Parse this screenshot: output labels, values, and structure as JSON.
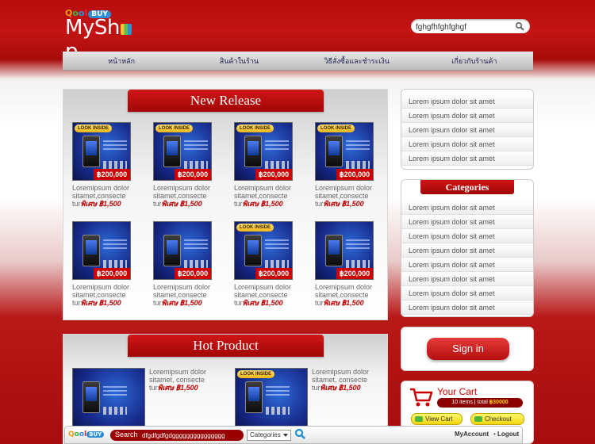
{
  "header": {
    "logo_small": [
      "Q",
      "o",
      "o",
      "l"
    ],
    "logo_buy": "BUY",
    "logo_big_1": "MySh",
    "logo_big_2": "p",
    "search_value": "fghgfhfghfghgf"
  },
  "nav": [
    "หน้าหลัก",
    "สินค้าในร้าน",
    "วิธีสั่งซื้อและชำระเงิน",
    "เกี่ยวกับร้านค้า"
  ],
  "new_release": {
    "title": "New Release",
    "products": [
      {
        "badge": "LOOK INSIDE",
        "price": "฿200,000",
        "desc": "Loremipsum dolor sitamet,consecte tur",
        "sale": "พิเศษ ฿1,500"
      },
      {
        "badge": "LOOK INSIDE",
        "price": "฿200,000",
        "desc": "Loremipsum dolor sitamet,consecte tur",
        "sale": "พิเศษ ฿1,500"
      },
      {
        "badge": "LOOK INSIDE",
        "price": "฿200,000",
        "desc": "Loremipsum dolor sitamet,consecte tur",
        "sale": "พิเศษ ฿1,500"
      },
      {
        "badge": "LOOK INSIDE",
        "price": "฿200,000",
        "desc": "Loremipsum dolor sitamet,consecte tur",
        "sale": "พิเศษ ฿1,500"
      },
      {
        "badge": "",
        "price": "฿200,000",
        "desc": "Loremipsum dolor sitamet,consecte tur",
        "sale": "พิเศษ ฿1,500"
      },
      {
        "badge": "",
        "price": "฿200,000",
        "desc": "Loremipsum dolor sitamet,consecte tur",
        "sale": "พิเศษ ฿1,500"
      },
      {
        "badge": "LOOK INSIDE",
        "price": "฿200,000",
        "desc": "Loremipsum dolor sitamet,consecte tur",
        "sale": "พิเศษ ฿1,500"
      },
      {
        "badge": "",
        "price": "฿200,000",
        "desc": "Loremipsum dolor sitamet,consecte tur",
        "sale": "พิเศษ ฿1,500"
      }
    ]
  },
  "hot_product": {
    "title": "Hot Product",
    "products": [
      {
        "badge": "",
        "desc": "Loremipsum dolor sitamet, consecte tur",
        "sale": "พิเศษ ฿1,500"
      },
      {
        "badge": "LOOK INSIDE",
        "desc": "Loremipsum dolor sitamet, consecte tur",
        "sale": "พิเศษ ฿1,500"
      }
    ]
  },
  "sidebar_list": [
    "Lorem ipsum dolor sit amet",
    "Lorem ipsum dolor sit amet",
    "Lorem ipsum dolor sit amet",
    "Lorem ipsum dolor sit amet",
    "Lorem ipsum dolor sit amet"
  ],
  "categories": {
    "title": "Categories",
    "items": [
      "Lorem ipsum dolor sit amet",
      "Lorem ipsum dolor sit amet",
      "Lorem ipsum dolor sit amet",
      "Lorem ipsum dolor sit amet",
      "Lorem ipsum dolor sit amet",
      "Lorem ipsum dolor sit amet",
      "Lorem ipsum dolor sit amet",
      "Lorem ipsum dolor sit amet"
    ]
  },
  "signin_label": "Sign in",
  "cart": {
    "title": "Your Cart",
    "items_text": "10 items | total ",
    "total": "฿30000",
    "view_label": "View Cart",
    "checkout_label": "Checkout"
  },
  "bottombar": {
    "logo_buy": "BUY",
    "search_label": "Search",
    "search_value": "dfgdfgdfgdggggggggggggggg",
    "category_label": "Categories",
    "myaccount": "MyAccount",
    "logout": "Logout"
  },
  "colors": {
    "brand_red": "#c41414",
    "accent_yellow": "#f2d60e"
  }
}
